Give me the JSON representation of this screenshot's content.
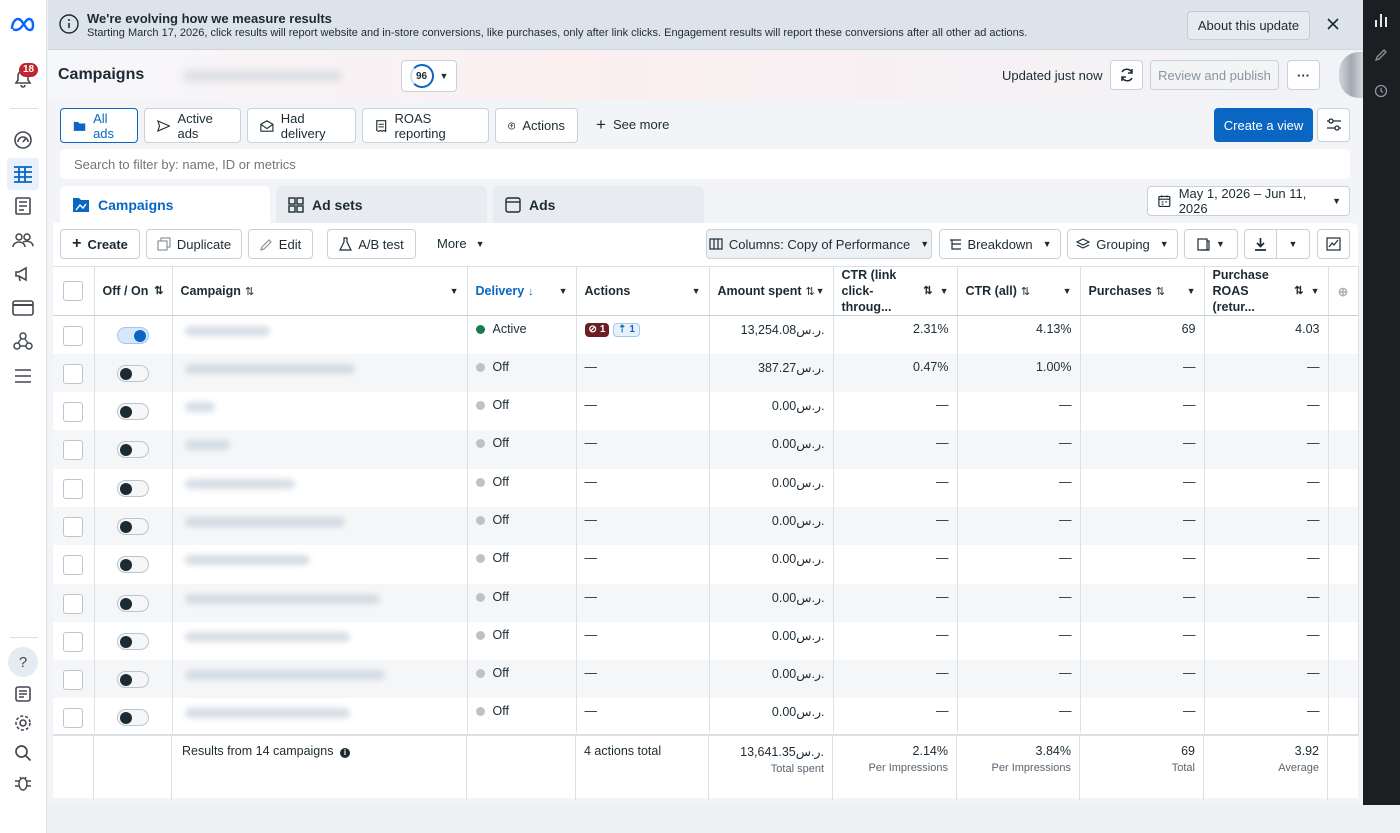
{
  "notifications_count": "18",
  "banner": {
    "title": "We're evolving how we measure results",
    "text": "Starting March 17, 2026, click results will report website and in-store conversions, like purchases, only after link clicks. Engagement results will report these conversions after all other ad actions.",
    "about_label": "About this update"
  },
  "header": {
    "title": "Campaigns",
    "score": "96",
    "updated": "Updated just now",
    "review_label": "Review and publish"
  },
  "views": {
    "items": [
      "All ads",
      "Active ads",
      "Had delivery",
      "ROAS reporting",
      "Actions"
    ],
    "see_more": "See more",
    "create_view": "Create a view"
  },
  "search": {
    "placeholder": "Search to filter by: name, ID or metrics"
  },
  "tabs": {
    "campaigns": "Campaigns",
    "adsets": "Ad sets",
    "ads": "Ads",
    "date_range": "May 1, 2026 – Jun 11, 2026"
  },
  "toolbar": {
    "create": "Create",
    "duplicate": "Duplicate",
    "edit": "Edit",
    "abtest": "A/B test",
    "more": "More",
    "columns": "Columns: Copy of Performance",
    "breakdown": "Breakdown",
    "grouping": "Grouping"
  },
  "columns": {
    "onoff": "Off / On",
    "campaign": "Campaign",
    "delivery": "Delivery",
    "actions": "Actions",
    "amount": "Amount spent",
    "ctr_link": "CTR (link click-throug...",
    "ctr_all": "CTR (all)",
    "purchases": "Purchases",
    "roas": "Purchase ROAS (retur..."
  },
  "rows": [
    {
      "on": true,
      "delivery": "Active",
      "actions": "",
      "amount": "13,254.08ر.س.",
      "ctr_link": "2.31%",
      "ctr_all": "4.13%",
      "purchases": "69",
      "roas": "4.03"
    },
    {
      "on": false,
      "delivery": "Off",
      "actions": "—",
      "amount": "387.27ر.س.",
      "ctr_link": "0.47%",
      "ctr_all": "1.00%",
      "purchases": "—",
      "roas": "—"
    },
    {
      "on": false,
      "delivery": "Off",
      "actions": "—",
      "amount": "0.00ر.س.",
      "ctr_link": "—",
      "ctr_all": "—",
      "purchases": "—",
      "roas": "—"
    },
    {
      "on": false,
      "delivery": "Off",
      "actions": "—",
      "amount": "0.00ر.س.",
      "ctr_link": "—",
      "ctr_all": "—",
      "purchases": "—",
      "roas": "—"
    },
    {
      "on": false,
      "delivery": "Off",
      "actions": "—",
      "amount": "0.00ر.س.",
      "ctr_link": "—",
      "ctr_all": "—",
      "purchases": "—",
      "roas": "—"
    },
    {
      "on": false,
      "delivery": "Off",
      "actions": "—",
      "amount": "0.00ر.س.",
      "ctr_link": "—",
      "ctr_all": "—",
      "purchases": "—",
      "roas": "—"
    },
    {
      "on": false,
      "delivery": "Off",
      "actions": "—",
      "amount": "0.00ر.س.",
      "ctr_link": "—",
      "ctr_all": "—",
      "purchases": "—",
      "roas": "—"
    },
    {
      "on": false,
      "delivery": "Off",
      "actions": "—",
      "amount": "0.00ر.س.",
      "ctr_link": "—",
      "ctr_all": "—",
      "purchases": "—",
      "roas": "—"
    },
    {
      "on": false,
      "delivery": "Off",
      "actions": "—",
      "amount": "0.00ر.س.",
      "ctr_link": "—",
      "ctr_all": "—",
      "purchases": "—",
      "roas": "—"
    },
    {
      "on": false,
      "delivery": "Off",
      "actions": "—",
      "amount": "0.00ر.س.",
      "ctr_link": "—",
      "ctr_all": "—",
      "purchases": "—",
      "roas": "—"
    },
    {
      "on": false,
      "delivery": "Off",
      "actions": "—",
      "amount": "0.00ر.س.",
      "ctr_link": "—",
      "ctr_all": "—",
      "purchases": "—",
      "roas": "—"
    }
  ],
  "row1_action_pills": [
    "1",
    "1"
  ],
  "footer": {
    "results": "Results from 14 campaigns",
    "actions": "4 actions total",
    "amount": "13,641.35ر.س.",
    "amount_sub": "Total spent",
    "ctr_link": "2.14%",
    "ctr_link_sub": "Per Impressions",
    "ctr_all": "3.84%",
    "ctr_all_sub": "Per Impressions",
    "purchases": "69",
    "purchases_sub": "Total",
    "roas": "3.92",
    "roas_sub": "Average"
  },
  "colors": {
    "accent": "#0a66c2",
    "create_green": "#126c3f",
    "active_dot": "#1d7a4a",
    "badge_red": "#c0262d"
  }
}
